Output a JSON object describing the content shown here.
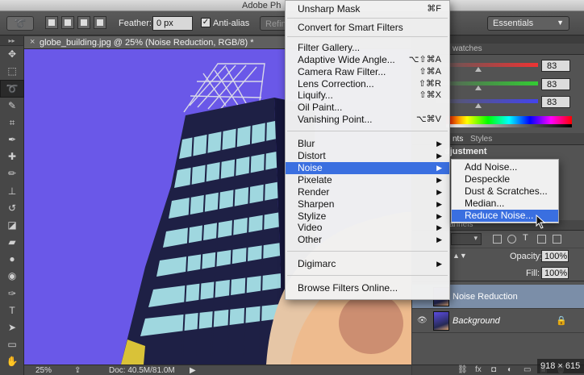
{
  "app": {
    "title": "Adobe Ph"
  },
  "options_bar": {
    "feather_label": "Feather:",
    "feather_value": "0 px",
    "anti_alias_label": "Anti-alias",
    "refine_label": "Refin",
    "workspace_value": "Essentials"
  },
  "document": {
    "tab_title": "globe_building.jpg @ 25% (Noise Reduction, RGB/8) *",
    "zoom": "25%",
    "doc_size": "Doc: 40.5M/81.0M"
  },
  "panels": {
    "swatches_tab": "watches",
    "color_values": [
      "83",
      "83",
      "83"
    ],
    "adjustments_tab": "nts",
    "styles_tab": "Styles",
    "adjustments_heading": "djustment",
    "layers_tab": "annels",
    "opacity_label": "Opacity:",
    "opacity_value": "100%",
    "fill_label": "Fill:",
    "fill_value": "100%",
    "layers": [
      {
        "name": "Noise Reduction"
      },
      {
        "name": "Background"
      }
    ],
    "dimensions_badge": "918 × 615"
  },
  "filter_menu": {
    "items": [
      {
        "label": "Unsharp Mask",
        "shortcut": "⌘F"
      },
      {
        "label": "Convert for Smart Filters"
      },
      {
        "label": "Filter Gallery..."
      },
      {
        "label": "Adaptive Wide Angle...",
        "shortcut": "⌥⇧⌘A"
      },
      {
        "label": "Camera Raw Filter...",
        "shortcut": "⇧⌘A"
      },
      {
        "label": "Lens Correction...",
        "shortcut": "⇧⌘R"
      },
      {
        "label": "Liquify...",
        "shortcut": "⇧⌘X"
      },
      {
        "label": "Oil Paint..."
      },
      {
        "label": "Vanishing Point...",
        "shortcut": "⌥⌘V"
      },
      {
        "label": "Blur"
      },
      {
        "label": "Distort"
      },
      {
        "label": "Noise"
      },
      {
        "label": "Pixelate"
      },
      {
        "label": "Render"
      },
      {
        "label": "Sharpen"
      },
      {
        "label": "Stylize"
      },
      {
        "label": "Video"
      },
      {
        "label": "Other"
      },
      {
        "label": "Digimarc"
      },
      {
        "label": "Browse Filters Online..."
      }
    ]
  },
  "noise_submenu": {
    "items": [
      {
        "label": "Add Noise..."
      },
      {
        "label": "Despeckle"
      },
      {
        "label": "Dust & Scratches..."
      },
      {
        "label": "Median..."
      },
      {
        "label": "Reduce Noise..."
      }
    ]
  },
  "colors": {
    "menu_highlight": "#3a6fe0",
    "canvas_sky": "#6a58e8",
    "selected_layer": "#7b8ea8"
  }
}
